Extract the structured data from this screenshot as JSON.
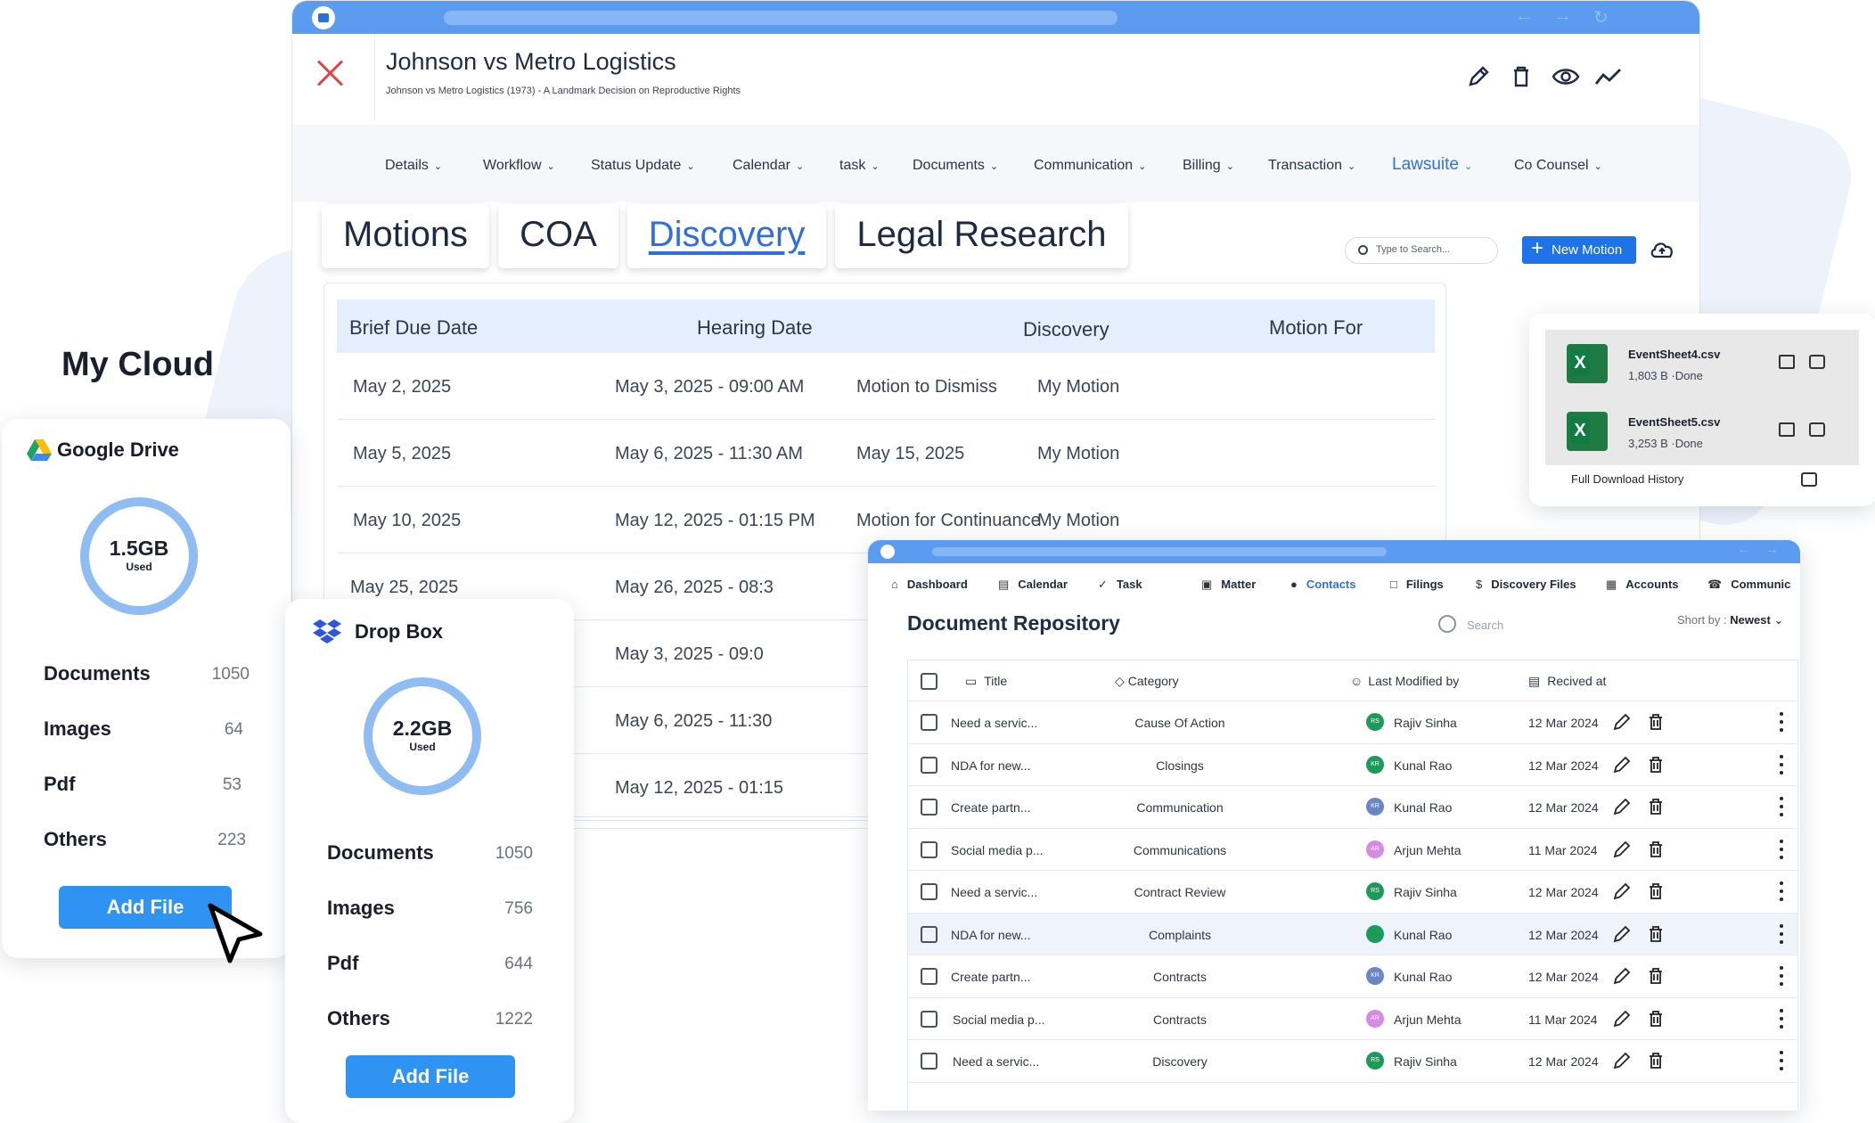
{
  "case": {
    "title": "Johnson vs Metro Logistics",
    "subtitle": "Johnson vs Metro Logistics (1973) - A Landmark Decision on Reproductive Rights",
    "header_icons": [
      "edit-icon",
      "trash-icon",
      "eye-icon",
      "trend-icon"
    ]
  },
  "nav": [
    "Details",
    "Workflow",
    "Status Update",
    "Calendar",
    "task",
    "Documents",
    "Communication",
    "Billing",
    "Transaction",
    "Lawsuite",
    "Co Counsel"
  ],
  "nav_active": "Lawsuite",
  "tabs": [
    "Motions",
    "COA",
    "Discovery",
    "Legal Research"
  ],
  "tab_active": "Discovery",
  "search_placeholder": "Type to Search...",
  "new_motion_label": "New Motion",
  "motions_table": {
    "headers": [
      "Brief Due Date",
      "Hearing Date",
      "Discovery",
      "Motion For"
    ],
    "rows": [
      [
        "May 2, 2025",
        "May 3, 2025 - 09:00 AM",
        "Motion to Dismiss",
        "My Motion"
      ],
      [
        "May 5, 2025",
        "May 6, 2025 - 11:30 AM",
        "May 15, 2025",
        "My Motion"
      ],
      [
        "May 10, 2025",
        "May 12, 2025 - 01:15 PM",
        "Motion for Continuance",
        "My Motion"
      ],
      [
        "May 25, 2025",
        "May 26, 2025 - 08:3",
        "",
        ""
      ],
      [
        "",
        "May 3, 2025 - 09:0",
        "",
        ""
      ],
      [
        "",
        "May 6, 2025 - 11:30",
        "",
        ""
      ],
      [
        "",
        "May 12, 2025 - 01:15",
        "",
        ""
      ]
    ]
  },
  "my_cloud": {
    "title": "My Cloud",
    "google": {
      "name": "Google Drive",
      "used": "1.5GB",
      "used_label": "Used",
      "stats": [
        [
          "Documents",
          "1050"
        ],
        [
          "Images",
          "64"
        ],
        [
          "Pdf",
          "53"
        ],
        [
          "Others",
          "223"
        ]
      ],
      "button": "Add File"
    },
    "dropbox": {
      "name": "Drop Box",
      "used": "2.2GB",
      "used_label": "Used",
      "stats": [
        [
          "Documents",
          "1050"
        ],
        [
          "Images",
          "756"
        ],
        [
          "Pdf",
          "644"
        ],
        [
          "Others",
          "1222"
        ]
      ],
      "button": "Add File"
    }
  },
  "downloads": {
    "items": [
      {
        "name": "EventSheet4.csv",
        "size": "1,803 B",
        "status": "Done"
      },
      {
        "name": "EventSheet5.csv",
        "size": "3,253 B",
        "status": "Done"
      }
    ],
    "history_label": "Full Download History"
  },
  "repo": {
    "nav": [
      "Dashboard",
      "Calendar",
      "Task",
      "Matter",
      "Contacts",
      "Filings",
      "Discovery Files",
      "Accounts",
      "Communic"
    ],
    "nav_active": "Contacts",
    "title": "Document Repository",
    "search_placeholder": "Search",
    "sort_label": "Short by :",
    "sort_value": "Newest",
    "headers": [
      "Title",
      "Category",
      "Last Modified by",
      "Recived at"
    ],
    "rows": [
      {
        "title": "Need a servic...",
        "category": "Cause Of Action",
        "initials": "RS",
        "user": "Rajiv Sinha",
        "date": "12 Mar 2024",
        "color": "#1a9b5a"
      },
      {
        "title": "NDA for new...",
        "category": "Closings",
        "initials": "KR",
        "user": "Kunal Rao",
        "date": "12 Mar 2024",
        "color": "#1a9b5a"
      },
      {
        "title": "Create partn...",
        "category": "Communication",
        "initials": "KR",
        "user": "Kunal Rao",
        "date": "12 Mar 2024",
        "color": "#6a86c4"
      },
      {
        "title": "Social media p...",
        "category": "Communications",
        "initials": "AR",
        "user": "Arjun Mehta",
        "date": "11 Mar 2024",
        "color": "#d58ae6"
      },
      {
        "title": "Need a servic...",
        "category": "Contract Review",
        "initials": "RS",
        "user": "Rajiv Sinha",
        "date": "12 Mar 2024",
        "color": "#1a9b5a"
      },
      {
        "title": "NDA for new...",
        "category": "Complaints",
        "initials": "",
        "user": "Kunal Rao",
        "date": "12 Mar 2024",
        "color": "#1a9b5a"
      },
      {
        "title": "Create partn...",
        "category": "Contracts",
        "initials": "KR",
        "user": "Kunal Rao",
        "date": "12 Mar 2024",
        "color": "#6a86c4"
      },
      {
        "title": "Social media p...",
        "category": "Contracts",
        "initials": "AR",
        "user": "Arjun Mehta",
        "date": "11 Mar 2024",
        "color": "#d58ae6"
      },
      {
        "title": "Need a servic...",
        "category": "Discovery",
        "initials": "RS",
        "user": "Rajiv Sinha",
        "date": "12 Mar 2024",
        "color": "#1a9b5a"
      }
    ]
  }
}
